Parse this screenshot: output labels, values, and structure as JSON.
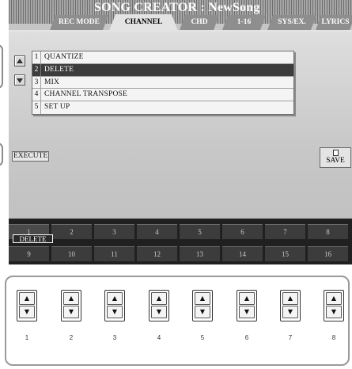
{
  "title": "SONG CREATOR : NewSong",
  "tabs": [
    {
      "label": "REC MODE",
      "active": false
    },
    {
      "label": "CHANNEL",
      "active": true
    },
    {
      "label": "CHD",
      "active": false
    },
    {
      "label": "1-16",
      "active": false
    },
    {
      "label": "SYS/EX.",
      "active": false
    },
    {
      "label": "LYRICS",
      "active": false
    }
  ],
  "menu": [
    {
      "num": "1",
      "label": "QUANTIZE",
      "selected": false
    },
    {
      "num": "2",
      "label": "DELETE",
      "selected": true
    },
    {
      "num": "3",
      "label": "MIX",
      "selected": false
    },
    {
      "num": "4",
      "label": "CHANNEL  TRANSPOSE",
      "selected": false
    },
    {
      "num": "5",
      "label": "SET UP",
      "selected": false
    }
  ],
  "execute_label": "EXECUTE",
  "save_label": "SAVE",
  "delete_tag": "DELETE",
  "row1": [
    "1",
    "2",
    "3",
    "4",
    "5",
    "6",
    "7",
    "8"
  ],
  "row2": [
    "9",
    "10",
    "11",
    "12",
    "13",
    "14",
    "15",
    "16"
  ],
  "panel_buttons": [
    "1",
    "2",
    "3",
    "4",
    "5",
    "6",
    "7",
    "8"
  ],
  "arrow_up": "▲",
  "arrow_down": "▼"
}
